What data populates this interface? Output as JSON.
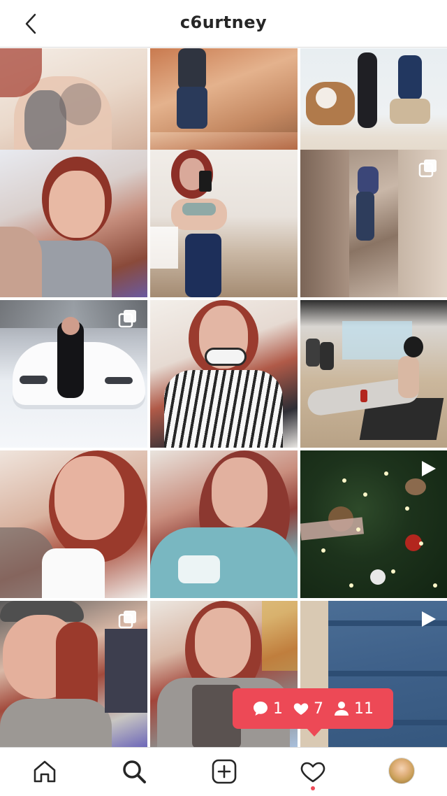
{
  "header": {
    "username": "c6urtney"
  },
  "notification": {
    "comments": "1",
    "likes": "7",
    "follows": "11"
  },
  "colors": {
    "accent": "#ed4956",
    "text": "#262626"
  },
  "icons": {
    "back": "chevron-left-icon",
    "home": "home-icon",
    "search": "search-icon",
    "add": "add-post-icon",
    "activity": "heart-icon",
    "profile": "profile-avatar"
  }
}
